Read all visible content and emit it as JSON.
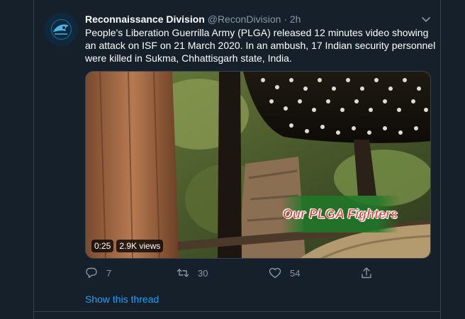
{
  "tweet": {
    "display_name": "Reconnaissance Division",
    "handle": "@ReconDivision",
    "separator": "·",
    "time": "2h",
    "text": "People's Liberation Guerrilla Army (PLGA) released 12 minutes video showing an attack on ISF on 21 March 2020. In an ambush, 17 Indian security personnel were killed in Sukma, Chhattisgarh state, India.",
    "avatar_icon": "recon-division-logo-icon",
    "caret_icon": "chevron-down-icon"
  },
  "media": {
    "overlay_text": "Our PLGA Fighters",
    "duration": "0:25",
    "views": "2.9K views"
  },
  "actions": {
    "reply_count": "7",
    "retweet_count": "30",
    "like_count": "54",
    "reply_icon": "reply-icon",
    "retweet_icon": "retweet-icon",
    "like_icon": "heart-icon",
    "share_icon": "share-icon"
  },
  "show_thread": "Show this thread",
  "colors": {
    "background": "#15202b",
    "border": "#38444d",
    "secondary_text": "#8899a6",
    "link": "#1da1f2"
  }
}
